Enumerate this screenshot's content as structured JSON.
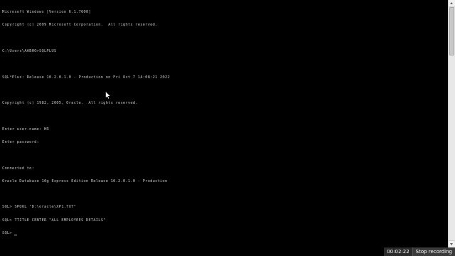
{
  "console": {
    "lines": [
      "Microsoft Windows [Version 6.1.7600]",
      "Copyright (c) 2009 Microsoft Corporation.  All rights reserved.",
      "",
      "C:\\Users\\AABHO>SQLPLUS",
      "",
      "SQL*Plus: Release 10.2.0.1.0 - Production on Fri Oct 7 14:08:21 2022",
      "",
      "Copyright (c) 1982, 2005, Oracle.  All rights reserved.",
      "",
      "Enter user-name: HR",
      "Enter password:",
      "",
      "Connected to:",
      "Oracle Database 10g Express Edition Release 10.2.0.1.0 - Production",
      "",
      "SQL> SPOOL \"D:\\oracle\\XP1.TXT\"",
      "SQL> TTITLE CENTER \"ALL EMPLOYEES DETAILS\"",
      "SQL> "
    ]
  },
  "recording": {
    "time": "00:02:22",
    "stop_label": "Stop recording"
  }
}
